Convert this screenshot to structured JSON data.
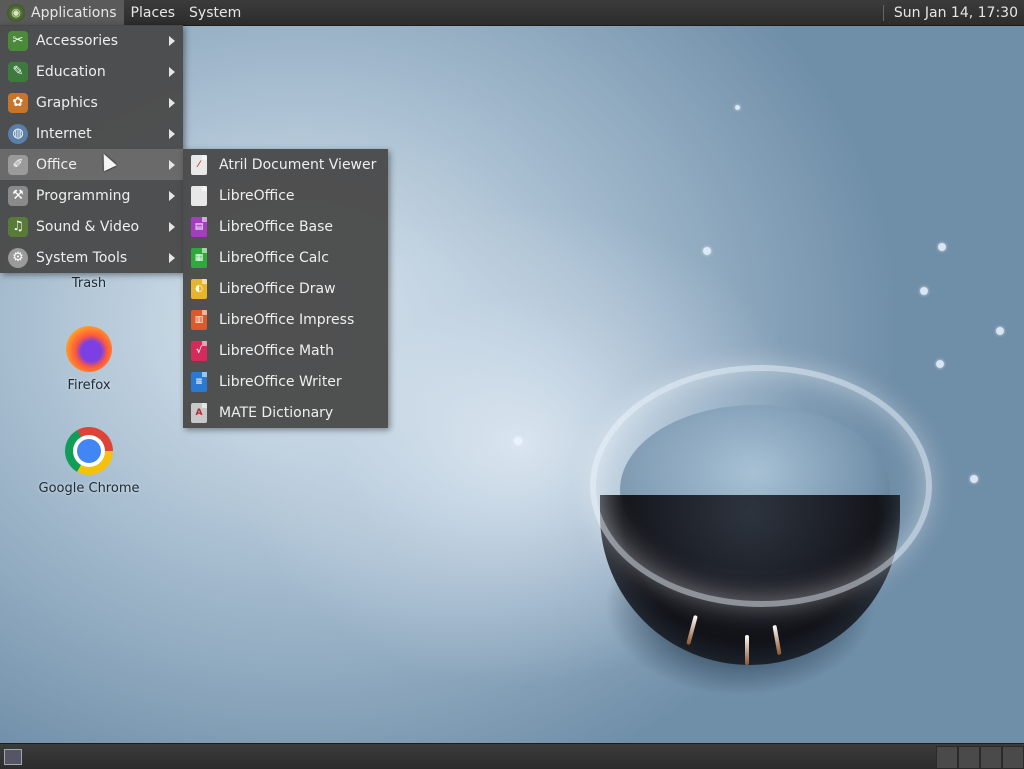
{
  "top_panel": {
    "menus": [
      "Applications",
      "Places",
      "System"
    ],
    "clock": "Sun Jan 14, 17:30"
  },
  "applications_menu": {
    "items": [
      {
        "label": "Accessories",
        "icon": "accessories-icon",
        "color": "#4a8a3a"
      },
      {
        "label": "Education",
        "icon": "education-icon",
        "color": "#3e7a3e"
      },
      {
        "label": "Graphics",
        "icon": "graphics-icon",
        "color": "#c8742a"
      },
      {
        "label": "Internet",
        "icon": "internet-icon",
        "color": "#5a7fa8"
      },
      {
        "label": "Office",
        "icon": "office-icon",
        "color": "#9a9a9a"
      },
      {
        "label": "Programming",
        "icon": "programming-icon",
        "color": "#8a8a8a"
      },
      {
        "label": "Sound & Video",
        "icon": "sound-video-icon",
        "color": "#5a7a3a"
      },
      {
        "label": "System Tools",
        "icon": "system-tools-icon",
        "color": "#9a9a9a"
      }
    ],
    "active_item": "Office"
  },
  "office_submenu": {
    "items": [
      {
        "label": "Atril Document Viewer",
        "icon": "atril-icon",
        "color": "#c83a2a"
      },
      {
        "label": "LibreOffice",
        "icon": "libreoffice-icon",
        "color": "#e8e8e8"
      },
      {
        "label": "LibreOffice Base",
        "icon": "libreoffice-base-icon",
        "color": "#a23fbf"
      },
      {
        "label": "LibreOffice Calc",
        "icon": "libreoffice-calc-icon",
        "color": "#2faa3a"
      },
      {
        "label": "LibreOffice Draw",
        "icon": "libreoffice-draw-icon",
        "color": "#e8b52a"
      },
      {
        "label": "LibreOffice Impress",
        "icon": "libreoffice-impress-icon",
        "color": "#e0582a"
      },
      {
        "label": "LibreOffice Math",
        "icon": "libreoffice-math-icon",
        "color": "#d62a5a"
      },
      {
        "label": "LibreOffice Writer",
        "icon": "libreoffice-writer-icon",
        "color": "#2a7ad2"
      },
      {
        "label": "MATE Dictionary",
        "icon": "dictionary-icon",
        "color": "#c8c8c8"
      }
    ]
  },
  "desktop_icons": [
    {
      "label": "Trash"
    },
    {
      "label": "Firefox"
    },
    {
      "label": "Google Chrome"
    }
  ]
}
